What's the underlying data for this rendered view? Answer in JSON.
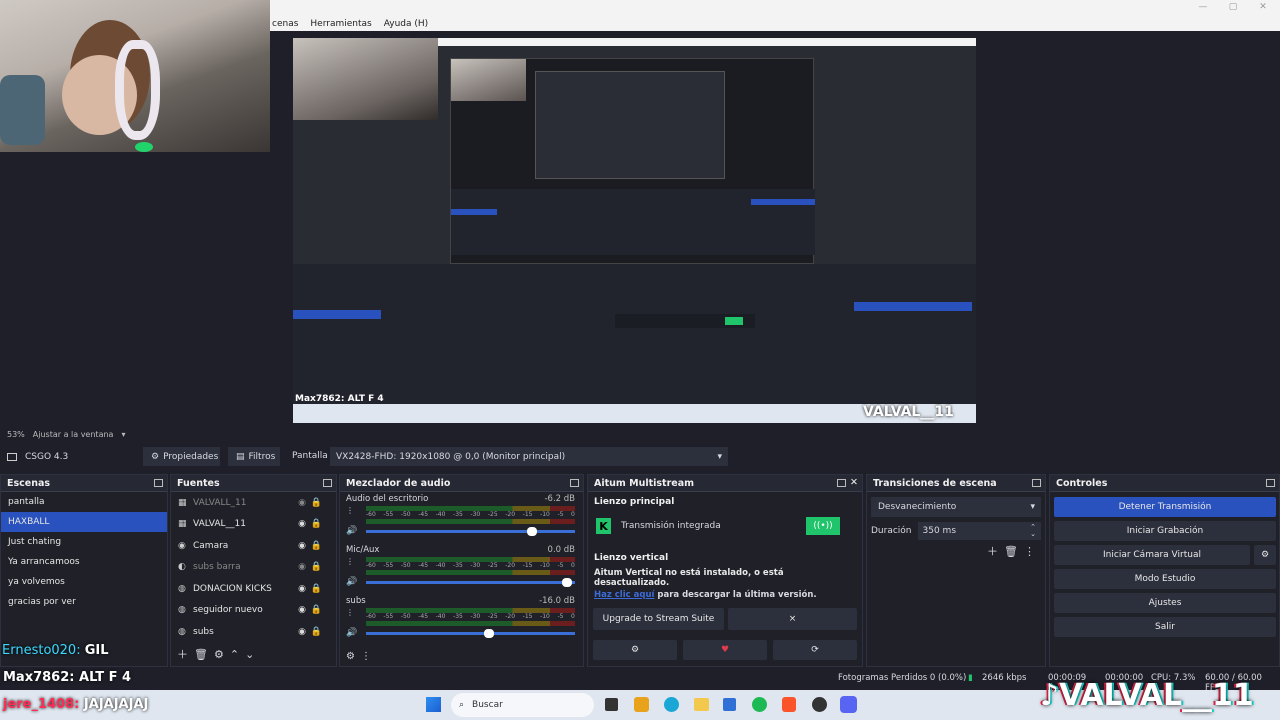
{
  "menu": {
    "items": [
      "cenas",
      "Herramientas",
      "Ayuda (H)"
    ]
  },
  "preview_footer": {
    "zoom": "53%",
    "fit_label": "Ajustar a la ventana"
  },
  "source_toolbar": {
    "current_source": "CSGO 4.3",
    "properties_label": "Propiedades",
    "filters_label": "Filtros",
    "display_label": "Pantalla",
    "monitor_value": "VX2428-FHD: 1920x1080 @ 0,0 (Monitor principal)"
  },
  "scenes": {
    "title": "Escenas",
    "items": [
      "pantalla",
      "HAXBALL",
      "Just chating",
      "Ya arrancamoos",
      "ya volvemos",
      "gracias por ver"
    ],
    "selected": 1
  },
  "sources": {
    "title": "Fuentes",
    "items": [
      "VALVALL_11",
      "VALVAL__11",
      "Camara",
      "subs barra",
      "DONACION KICKS",
      "seguidor nuevo",
      "subs"
    ]
  },
  "mixer": {
    "title": "Mezclador de audio",
    "channels": [
      {
        "name": "Audio del escritorio",
        "db": "-6.2 dB",
        "level": 0.82
      },
      {
        "name": "Mic/Aux",
        "db": "0.0 dB",
        "level": 1.0
      },
      {
        "name": "subs",
        "db": "-16.0 dB",
        "level": 0.6
      }
    ],
    "scale": [
      "-60",
      "-55",
      "-50",
      "-45",
      "-40",
      "-35",
      "-30",
      "-25",
      "-20",
      "-15",
      "-10",
      "-5",
      "0"
    ]
  },
  "multistream": {
    "title": "Aitum Multistream",
    "main_canvas": "Lienzo principal",
    "integrated": "Transmisión integrada",
    "vertical_title": "Lienzo vertical",
    "vertical_msg": "Aitum Vertical no está instalado, o está desactualizado.",
    "link_text": "Haz clic aquí",
    "link_rest": "para descargar la última versión.",
    "upgrade": "Upgrade to Stream Suite",
    "close_x": "×"
  },
  "transitions": {
    "title": "Transiciones de escena",
    "selected": "Desvanecimiento",
    "duration_label": "Duración",
    "duration_value": "350 ms"
  },
  "controls": {
    "title": "Controles",
    "buttons": [
      "Detener Transmisión",
      "Iniciar Grabación",
      "Iniciar Cámara Virtual",
      "Modo Estudio",
      "Ajustes",
      "Salir"
    ]
  },
  "statusbar": {
    "dropped": "Fotogramas Perdidos 0 (0.0%)",
    "kbps": "2646 kbps",
    "live_time": "00:00:09",
    "rec_time": "00:00:00",
    "cpu": "CPU: 7.3%",
    "fps": "60.00 / 60.00 FPS"
  },
  "overlay": {
    "chat_user": "Ernesto020:",
    "chat_msg": "GIL",
    "alert1_user": "Max7862:",
    "alert1_msg": "ALT F 4",
    "alert2_user": "jere_1408:",
    "alert2_msg": "JAJAJAJAJ",
    "watermark": "VALVAL__11"
  },
  "taskbar": {
    "search": "Buscar"
  },
  "colors": {
    "accent": "#2a52be",
    "green": "#1fc46b",
    "panel": "#1f2028"
  }
}
